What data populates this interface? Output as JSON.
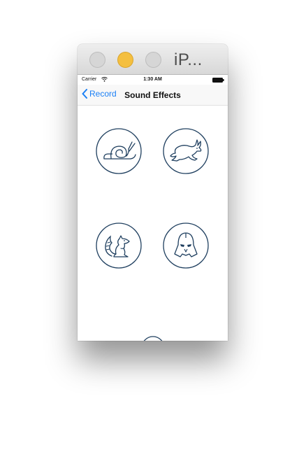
{
  "window": {
    "title": "iP..."
  },
  "status_bar": {
    "carrier": "Carrier",
    "time": "1:30 AM"
  },
  "nav": {
    "back_label": "Record",
    "title": "Sound Effects"
  },
  "effects": [
    {
      "name": "slow",
      "icon": "snail-icon"
    },
    {
      "name": "fast",
      "icon": "rabbit-icon"
    },
    {
      "name": "chipmunk",
      "icon": "squirrel-icon"
    },
    {
      "name": "vader",
      "icon": "darth-vader-icon"
    }
  ],
  "controls": {
    "stop_icon": "stop-icon"
  },
  "colors": {
    "icon_stroke": "#1f3f5f",
    "link_blue": "#1a7ff5",
    "minimize_yellow": "#f4bf3f"
  }
}
